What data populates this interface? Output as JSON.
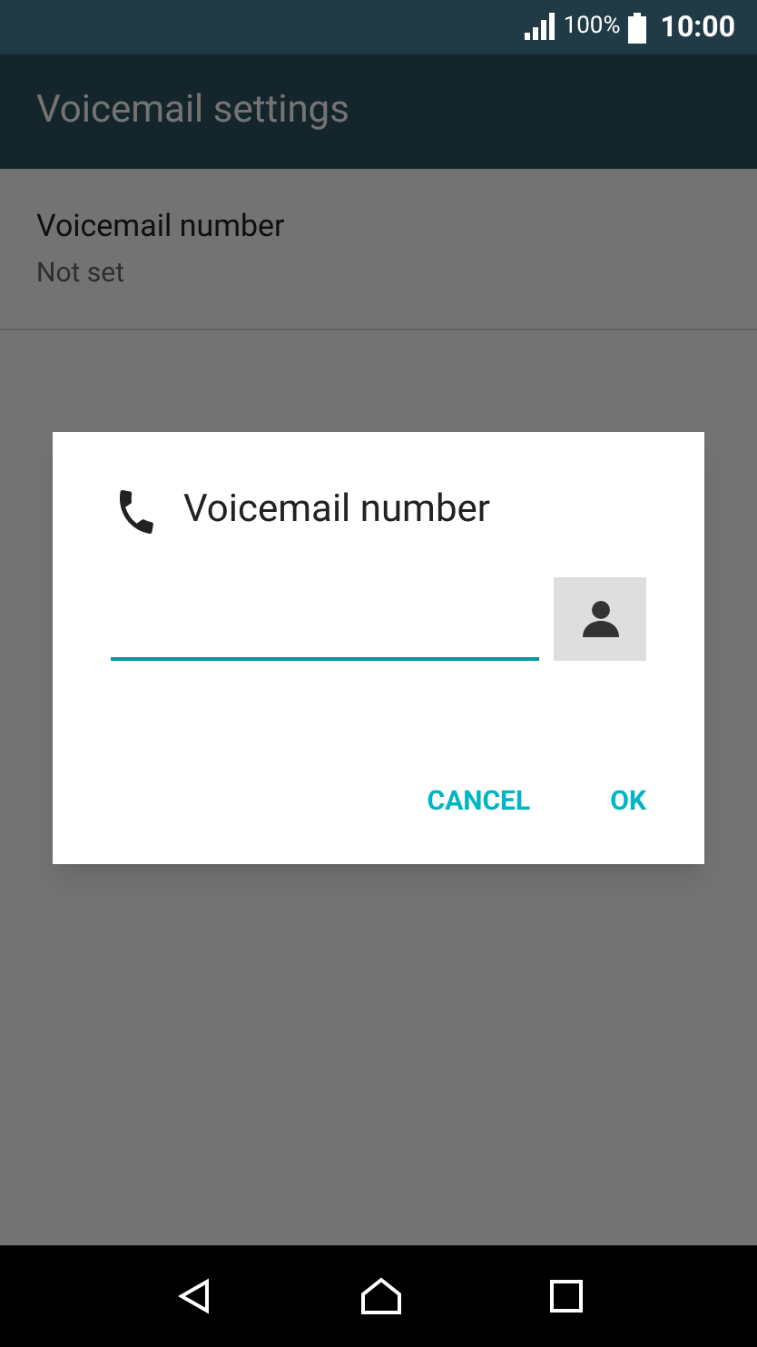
{
  "status_bar": {
    "battery": "100%",
    "time": "10:00"
  },
  "app_bar": {
    "title": "Voicemail settings"
  },
  "settings": [
    {
      "title": "Voicemail number",
      "subtitle": "Not set"
    }
  ],
  "dialog": {
    "title": "Voicemail number",
    "buttons": [
      "CANCEL",
      "OK"
    ]
  }
}
